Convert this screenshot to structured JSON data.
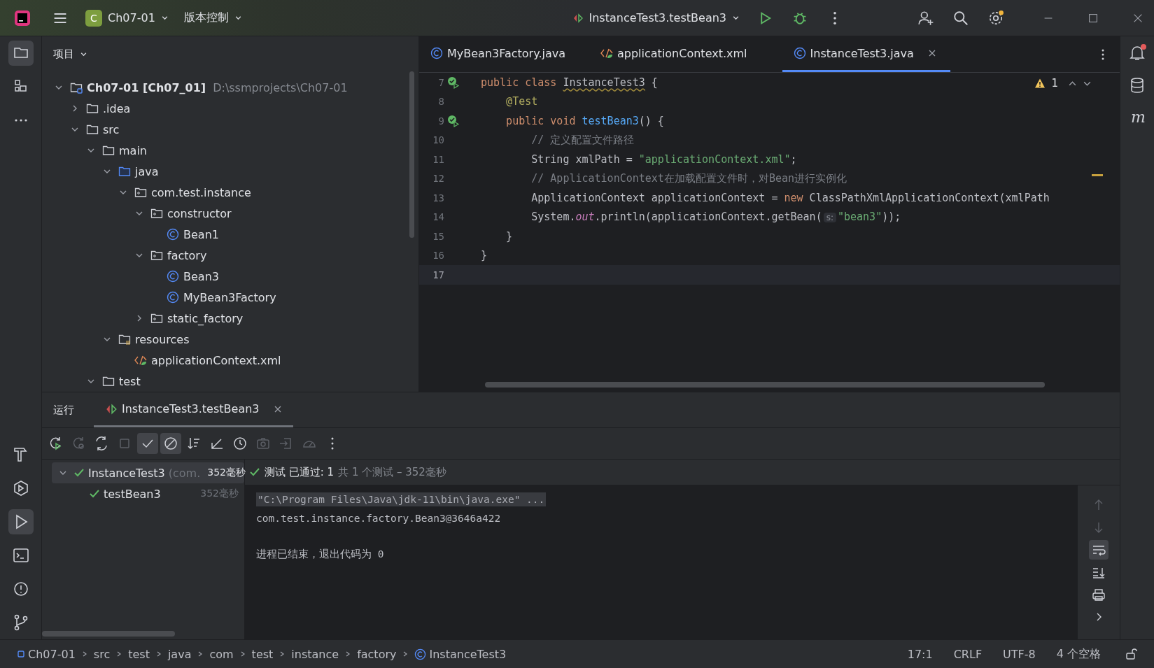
{
  "title_bar": {
    "project_badge": "C",
    "project": "Ch07-01",
    "vcs": "版本控制",
    "run_config": "InstanceTest3.testBean3"
  },
  "left_toolbar_top": [
    {
      "kind": "project",
      "selected": true
    },
    {
      "kind": "structure",
      "selected": false
    },
    {
      "kind": "more",
      "selected": false
    }
  ],
  "left_toolbar_bottom": [
    {
      "kind": "build",
      "selected": false
    },
    {
      "kind": "services",
      "selected": false
    },
    {
      "kind": "run",
      "selected": true
    },
    {
      "kind": "terminal",
      "selected": false
    },
    {
      "kind": "problems",
      "selected": false
    },
    {
      "kind": "git",
      "selected": false
    }
  ],
  "project_panel": {
    "title": "项目",
    "tree": [
      {
        "label": "Ch07-01 [Ch07_01]",
        "path": "D:\\ssmprojects\\Ch07-01",
        "kind": "module",
        "expanded": true,
        "children": [
          {
            "label": ".idea",
            "kind": "folder",
            "expanded": false
          },
          {
            "label": "src",
            "kind": "folder",
            "expanded": true,
            "children": [
              {
                "label": "main",
                "kind": "folder",
                "expanded": true,
                "children": [
                  {
                    "label": "java",
                    "kind": "source",
                    "expanded": true,
                    "children": [
                      {
                        "label": "com.test.instance",
                        "kind": "package",
                        "expanded": true,
                        "children": [
                          {
                            "label": "constructor",
                            "kind": "package",
                            "expanded": true,
                            "children": [
                              {
                                "label": "Bean1",
                                "kind": "class"
                              }
                            ]
                          },
                          {
                            "label": "factory",
                            "kind": "package",
                            "expanded": true,
                            "children": [
                              {
                                "label": "Bean3",
                                "kind": "class"
                              },
                              {
                                "label": "MyBean3Factory",
                                "kind": "class"
                              }
                            ]
                          },
                          {
                            "label": "static_factory",
                            "kind": "package",
                            "expanded": false
                          }
                        ]
                      }
                    ]
                  },
                  {
                    "label": "resources",
                    "kind": "resources",
                    "expanded": true,
                    "children": [
                      {
                        "label": "applicationContext.xml",
                        "kind": "xml"
                      }
                    ]
                  }
                ]
              },
              {
                "label": "test",
                "kind": "folder",
                "expanded": true
              }
            ]
          }
        ]
      }
    ]
  },
  "editor": {
    "tabs": [
      {
        "label": "MyBean3Factory.java",
        "kind": "class",
        "selected": false
      },
      {
        "label": "applicationContext.xml",
        "kind": "xml",
        "selected": false
      },
      {
        "label": "InstanceTest3.java",
        "kind": "class",
        "selected": true
      }
    ],
    "warnings": "1",
    "lines": [
      {
        "number": "7",
        "runnable": true,
        "current": false,
        "tokens": [
          {
            "text": "public class ",
            "kind": "keyword"
          },
          {
            "text": "InstanceTest3",
            "kind": "warned"
          },
          {
            "text": " {",
            "kind": "plain"
          }
        ]
      },
      {
        "number": "8",
        "runnable": false,
        "current": false,
        "tokens": [
          {
            "text": "    @Test",
            "kind": "annotation"
          }
        ]
      },
      {
        "number": "9",
        "runnable": true,
        "current": false,
        "tokens": [
          {
            "text": "    public void ",
            "kind": "keyword"
          },
          {
            "text": "testBean3",
            "kind": "method"
          },
          {
            "text": "() {",
            "kind": "plain"
          }
        ]
      },
      {
        "number": "10",
        "runnable": false,
        "current": false,
        "tokens": [
          {
            "text": "        // 定义配置文件路径",
            "kind": "comment"
          }
        ]
      },
      {
        "number": "11",
        "runnable": false,
        "current": false,
        "tokens": [
          {
            "text": "        String xmlPath = ",
            "kind": "plain"
          },
          {
            "text": "\"applicationContext.xml\"",
            "kind": "string"
          },
          {
            "text": ";",
            "kind": "plain"
          }
        ]
      },
      {
        "number": "12",
        "runnable": false,
        "current": false,
        "tokens": [
          {
            "text": "        // ApplicationContext在加载配置文件时，对Bean进行实例化",
            "kind": "comment"
          }
        ]
      },
      {
        "number": "13",
        "runnable": false,
        "current": false,
        "tokens": [
          {
            "text": "        ApplicationContext applicationContext = ",
            "kind": "plain"
          },
          {
            "text": "new ",
            "kind": "keyword"
          },
          {
            "text": "ClassPathXmlApplicationContext(xmlPath",
            "kind": "plain"
          }
        ]
      },
      {
        "number": "14",
        "runnable": false,
        "current": false,
        "tokens": [
          {
            "text": "        System.",
            "kind": "plain"
          },
          {
            "text": "out",
            "kind": "static"
          },
          {
            "text": ".println(applicationContext.getBean(",
            "kind": "plain"
          },
          {
            "text": "s:",
            "kind": "hint"
          },
          {
            "text": "\"bean3\"",
            "kind": "string"
          },
          {
            "text": "));",
            "kind": "plain"
          }
        ]
      },
      {
        "number": "15",
        "runnable": false,
        "current": false,
        "tokens": [
          {
            "text": "    }",
            "kind": "plain"
          }
        ]
      },
      {
        "number": "16",
        "runnable": false,
        "current": false,
        "tokens": [
          {
            "text": "}",
            "kind": "plain"
          }
        ]
      },
      {
        "number": "17",
        "runnable": false,
        "current": true
      }
    ]
  },
  "right_toolbar": [
    {
      "kind": "notifications",
      "badge": true
    },
    {
      "kind": "database",
      "badge": false
    },
    {
      "kind": "maven",
      "glyph": "m",
      "badge": false
    }
  ],
  "run_panel": {
    "title": "运行",
    "tabs": [
      {
        "label": "InstanceTest3.testBean3",
        "selected": true
      }
    ],
    "toolbar": [
      {
        "kind": "rerun",
        "on": false,
        "disabled": false
      },
      {
        "kind": "rerun-failed",
        "on": false,
        "disabled": true
      },
      {
        "kind": "toggle",
        "on": false,
        "disabled": false
      },
      {
        "kind": "stop",
        "on": false,
        "disabled": true
      },
      {
        "kind": "passed",
        "on": true,
        "disabled": false
      },
      {
        "kind": "ignored",
        "on": true,
        "disabled": false
      },
      {
        "kind": "sort",
        "on": false,
        "disabled": false
      },
      {
        "kind": "collapse",
        "on": false,
        "disabled": false
      },
      {
        "kind": "history",
        "on": false,
        "disabled": false
      },
      {
        "kind": "camera",
        "on": false,
        "disabled": true
      },
      {
        "kind": "import",
        "on": false,
        "disabled": true
      },
      {
        "kind": "gauge",
        "on": false,
        "disabled": true
      },
      {
        "kind": "more",
        "on": false,
        "disabled": false
      }
    ],
    "tests": [
      {
        "name": "InstanceTest3",
        "detail": "(com.",
        "time": "352毫秒",
        "passed": true,
        "selected": true,
        "expanded": true,
        "children": [
          {
            "name": "testBean3",
            "time": "352毫秒",
            "passed": true,
            "selected": false
          }
        ]
      }
    ],
    "summary": {
      "passed": true,
      "status": "测试 已通过: 1",
      "detail": "共 1 个测试 – 352毫秒"
    },
    "console": [
      {
        "kind": "command",
        "text": "\"C:\\Program Files\\Java\\jdk-11\\bin\\java.exe\" ..."
      },
      {
        "kind": "output",
        "text": "com.test.instance.factory.Bean3@3646a422"
      },
      {
        "kind": "exit",
        "text": "进程已结束，退出代码为 0"
      }
    ],
    "side_tools": [
      {
        "kind": "up",
        "on": false,
        "disabled": true
      },
      {
        "kind": "down",
        "on": false,
        "disabled": true
      },
      {
        "kind": "wrap",
        "on": true,
        "disabled": false
      },
      {
        "kind": "scroll-end",
        "on": false,
        "disabled": false
      },
      {
        "kind": "print",
        "on": false,
        "disabled": false
      },
      {
        "kind": "expand",
        "on": false,
        "disabled": false
      }
    ]
  },
  "status_bar": {
    "breadcrumbs": [
      {
        "label": "Ch07-01",
        "kind": "module"
      },
      {
        "label": "src",
        "kind": "folder"
      },
      {
        "label": "test",
        "kind": "folder"
      },
      {
        "label": "java",
        "kind": "folder"
      },
      {
        "label": "com",
        "kind": "folder"
      },
      {
        "label": "test",
        "kind": "folder"
      },
      {
        "label": "instance",
        "kind": "folder"
      },
      {
        "label": "factory",
        "kind": "folder"
      },
      {
        "label": "InstanceTest3",
        "kind": "class"
      }
    ],
    "items": [
      "17:1",
      "CRLF",
      "UTF-8",
      "4 个空格"
    ]
  }
}
